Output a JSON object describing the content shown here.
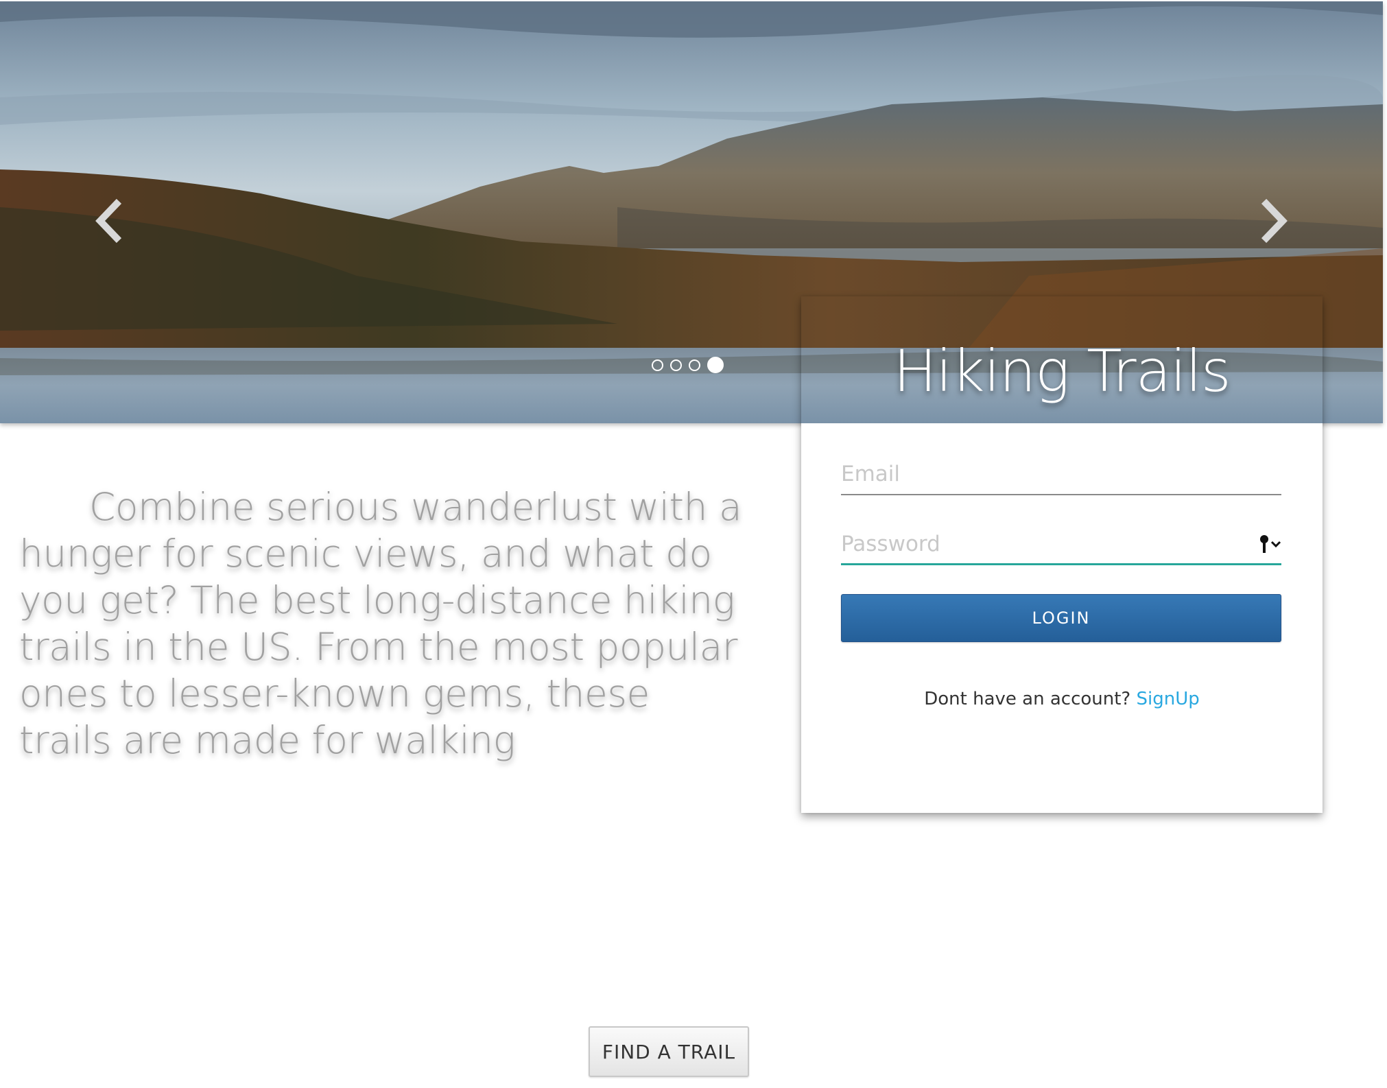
{
  "hero": {
    "image_description": "autumn mountain lake landscape",
    "prev_icon": "chevron-left-icon",
    "next_icon": "chevron-right-icon",
    "slide_count": 4,
    "active_slide": 4
  },
  "intro": {
    "text": "Combine serious wanderlust with a hunger for scenic views, and what do you get? The best long-distance hiking trails in the US. From the most popular ones to lesser-known gems, these trails are made for walking"
  },
  "login": {
    "title": "Hiking Trails",
    "email_placeholder": "Email",
    "password_placeholder": "Password",
    "password_icon": "key-dropdown-icon",
    "login_label": "LOGIN",
    "signup_prompt": "Dont have an account?",
    "signup_link": "SignUp",
    "accent_color": "#26a69a",
    "button_color": "#2d6ca8",
    "link_color": "#29a8e0"
  },
  "find_trail": {
    "label": "FIND A TRAIL"
  }
}
